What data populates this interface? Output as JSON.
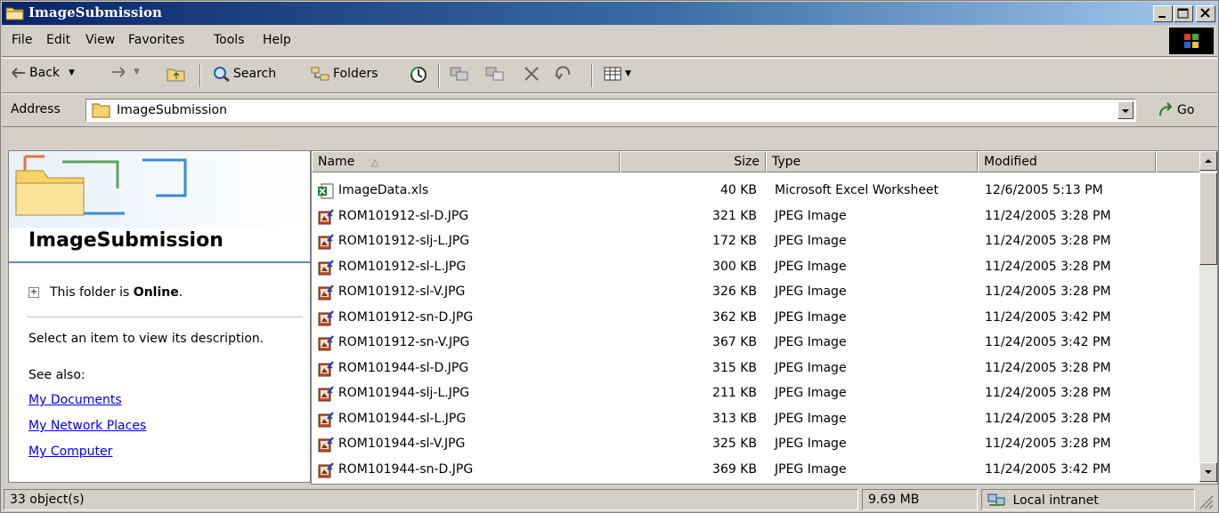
{
  "window": {
    "title": "ImageSubmission"
  },
  "menu": {
    "items": [
      "File",
      "Edit",
      "View",
      "Favorites",
      "Tools",
      "Help"
    ]
  },
  "toolbar": {
    "back": "Back",
    "search": "Search",
    "folders": "Folders"
  },
  "address": {
    "label": "Address",
    "value": "ImageSubmission",
    "go": "Go"
  },
  "left_panel": {
    "title": "ImageSubmission",
    "online_prefix": "This folder is ",
    "online_status": "Online",
    "online_suffix": ".",
    "select_hint": "Select an item to view its description.",
    "see_also": "See also:",
    "links": [
      "My Documents",
      "My Network Places",
      "My Computer"
    ]
  },
  "list": {
    "columns": [
      "Name",
      "Size",
      "Type",
      "Modified"
    ],
    "sort_indicator": "△",
    "rows": [
      {
        "name": "ImageData.xls",
        "size": "40 KB",
        "type": "Microsoft Excel Worksheet",
        "modified": "12/6/2005 5:13 PM",
        "icon": "excel-file-icon"
      },
      {
        "name": "ROM101912-sl-D.JPG",
        "size": "321 KB",
        "type": "JPEG Image",
        "modified": "11/24/2005 3:28 PM",
        "icon": "jpeg-file-icon"
      },
      {
        "name": "ROM101912-slj-L.JPG",
        "size": "172 KB",
        "type": "JPEG Image",
        "modified": "11/24/2005 3:28 PM",
        "icon": "jpeg-file-icon"
      },
      {
        "name": "ROM101912-sl-L.JPG",
        "size": "300 KB",
        "type": "JPEG Image",
        "modified": "11/24/2005 3:28 PM",
        "icon": "jpeg-file-icon"
      },
      {
        "name": "ROM101912-sl-V.JPG",
        "size": "326 KB",
        "type": "JPEG Image",
        "modified": "11/24/2005 3:28 PM",
        "icon": "jpeg-file-icon"
      },
      {
        "name": "ROM101912-sn-D.JPG",
        "size": "362 KB",
        "type": "JPEG Image",
        "modified": "11/24/2005 3:42 PM",
        "icon": "jpeg-file-icon"
      },
      {
        "name": "ROM101912-sn-V.JPG",
        "size": "367 KB",
        "type": "JPEG Image",
        "modified": "11/24/2005 3:42 PM",
        "icon": "jpeg-file-icon"
      },
      {
        "name": "ROM101944-sl-D.JPG",
        "size": "315 KB",
        "type": "JPEG Image",
        "modified": "11/24/2005 3:28 PM",
        "icon": "jpeg-file-icon"
      },
      {
        "name": "ROM101944-slj-L.JPG",
        "size": "211 KB",
        "type": "JPEG Image",
        "modified": "11/24/2005 3:28 PM",
        "icon": "jpeg-file-icon"
      },
      {
        "name": "ROM101944-sl-L.JPG",
        "size": "313 KB",
        "type": "JPEG Image",
        "modified": "11/24/2005 3:28 PM",
        "icon": "jpeg-file-icon"
      },
      {
        "name": "ROM101944-sl-V.JPG",
        "size": "325 KB",
        "type": "JPEG Image",
        "modified": "11/24/2005 3:28 PM",
        "icon": "jpeg-file-icon"
      },
      {
        "name": "ROM101944-sn-D.JPG",
        "size": "369 KB",
        "type": "JPEG Image",
        "modified": "11/24/2005 3:42 PM",
        "icon": "jpeg-file-icon"
      }
    ]
  },
  "status": {
    "objects": "33 object(s)",
    "size": "9.69 MB",
    "zone": "Local intranet"
  },
  "colors": {
    "title_start": "#0a246a",
    "title_end": "#a6caf0",
    "chrome": "#d4d0c8",
    "link": "#0000ee",
    "selection_rule": "#5b8ac6"
  }
}
